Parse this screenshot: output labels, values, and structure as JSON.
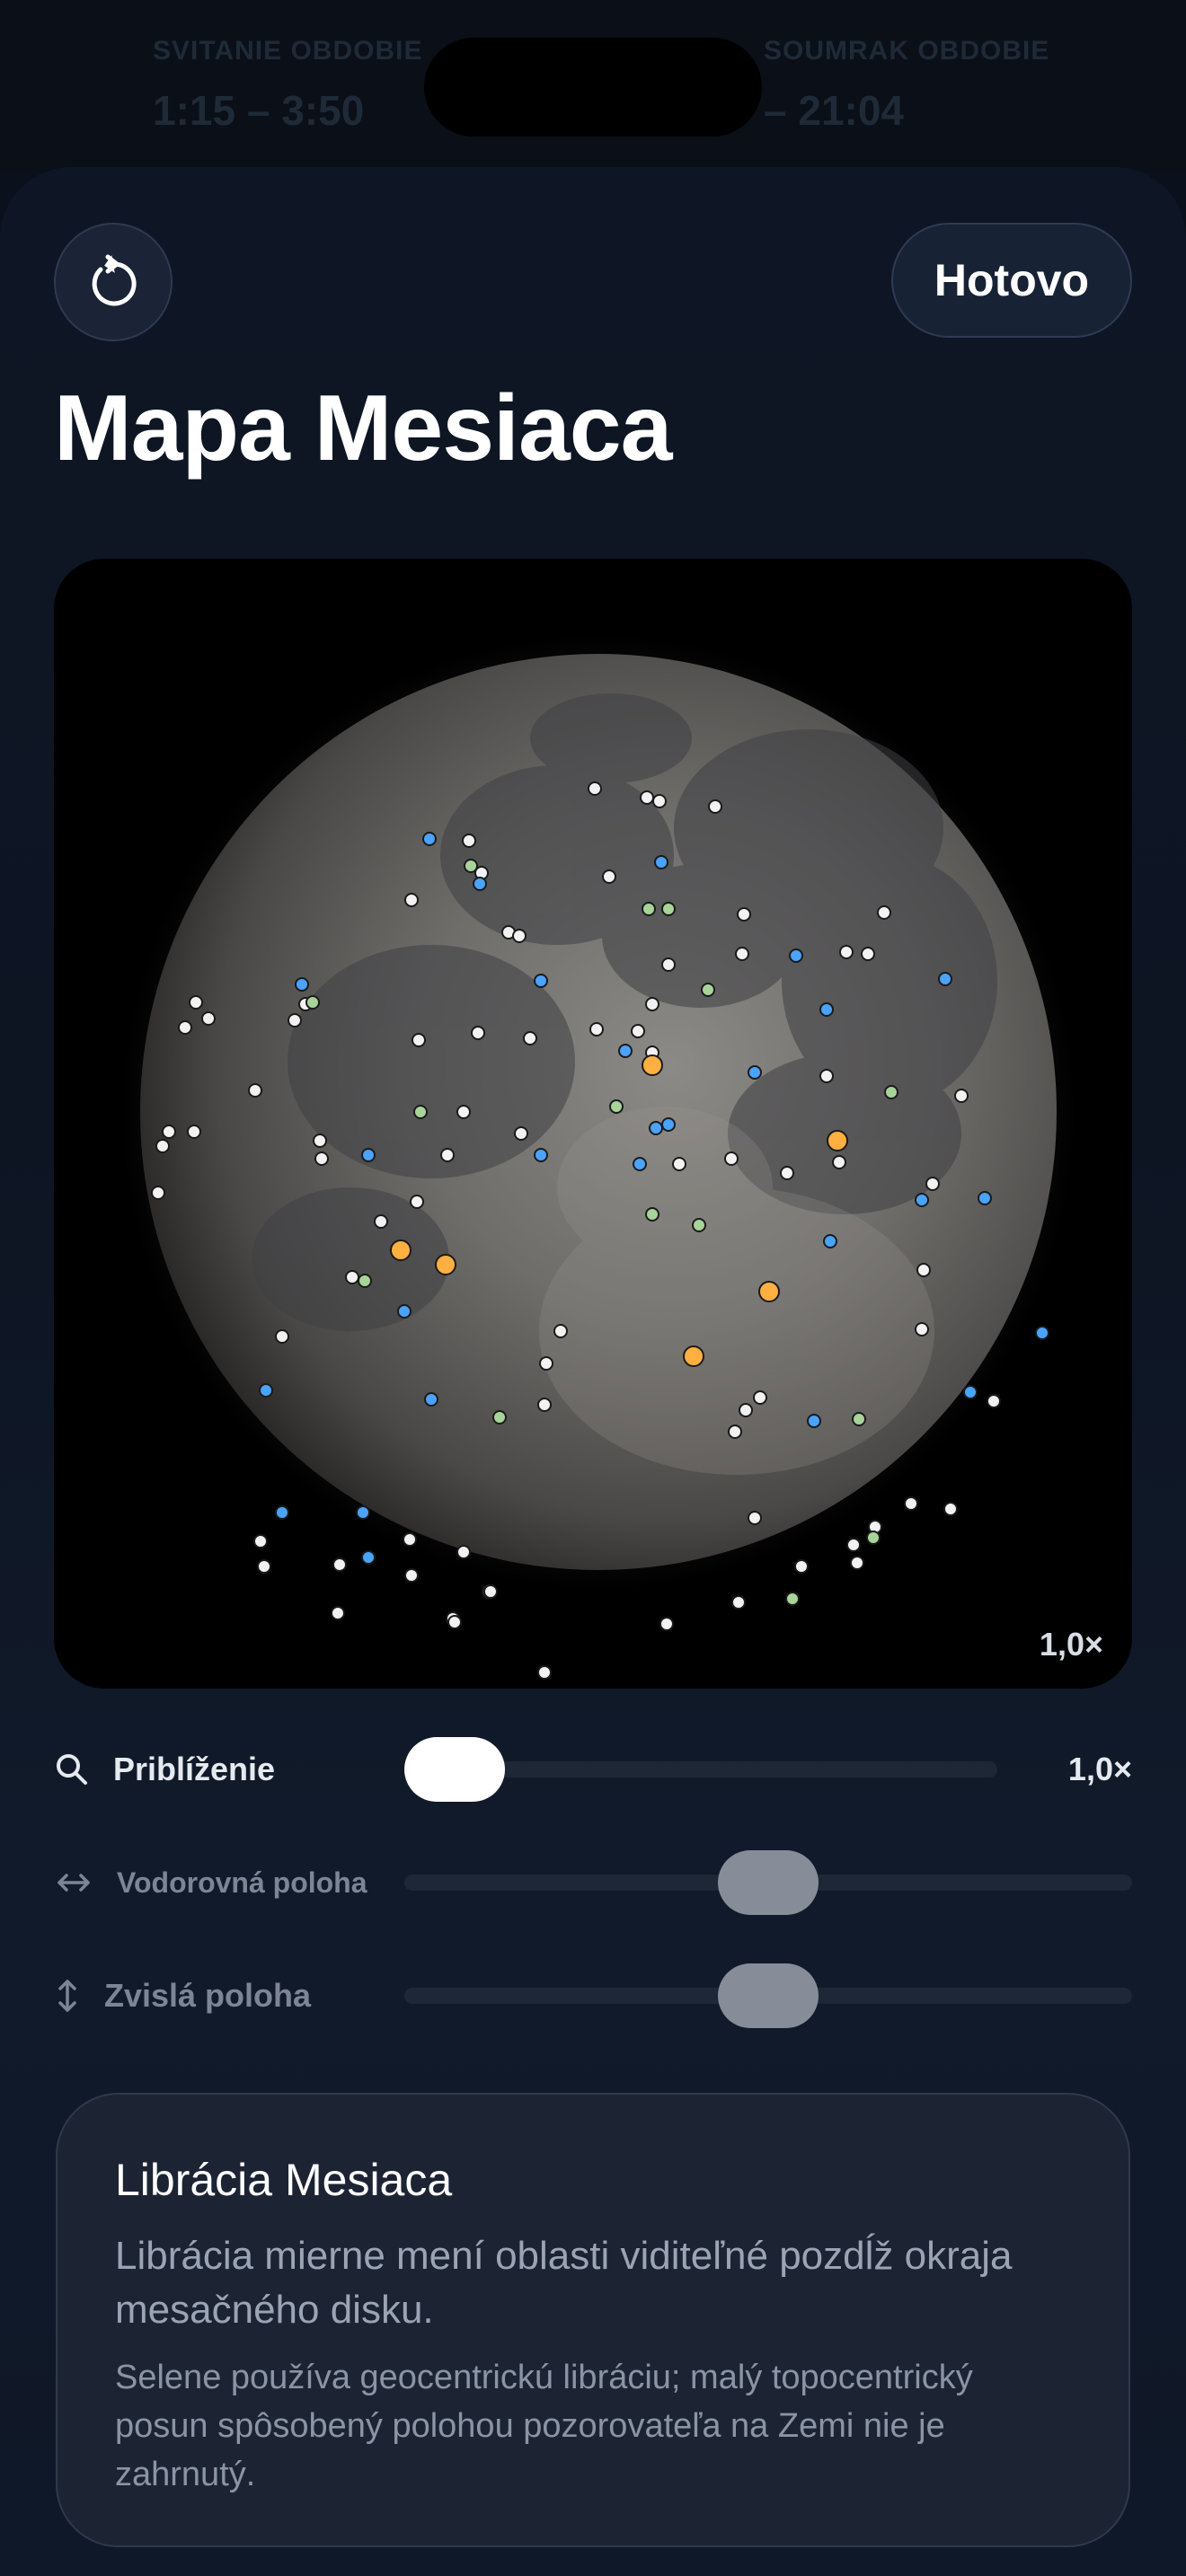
{
  "status_bar": {
    "left_label": "SVITANIE OBDOBIE",
    "left_value": "1:15 – 3:50",
    "right_label": "SOUMRAK OBDOBIE",
    "right_value": "– 21:04"
  },
  "header": {
    "reset_icon": "rotate-ccw-icon",
    "done_label": "Hotovo",
    "title": "Mapa Mesiaca"
  },
  "moon_map": {
    "zoom_badge": "1,0×",
    "marker_colors": {
      "white": "#f2f2f2",
      "blue": "#4aa3ff",
      "green": "#a8d49a",
      "orange": "#ffb040"
    }
  },
  "controls": {
    "zoom": {
      "label": "Priblíženie",
      "value": "1,0×",
      "icon": "magnifier-icon",
      "level": 0.0
    },
    "horizontal": {
      "label": "Vodorovná poloha",
      "icon": "horizontal-arrows-icon",
      "level": 0.5
    },
    "vertical": {
      "label": "Zvislá poloha",
      "icon": "vertical-arrows-icon",
      "level": 0.5
    }
  },
  "info": {
    "title": "Librácia Mesiaca",
    "body": "Librácia mierne mení oblasti viditeľné pozdĺž okraja mesačného disku.",
    "note": "Selene používa geocentrickú libráciu; malý topocentrický posun spôsobený polohou pozorovateľa na Zemi nie je zahrnutý."
  }
}
